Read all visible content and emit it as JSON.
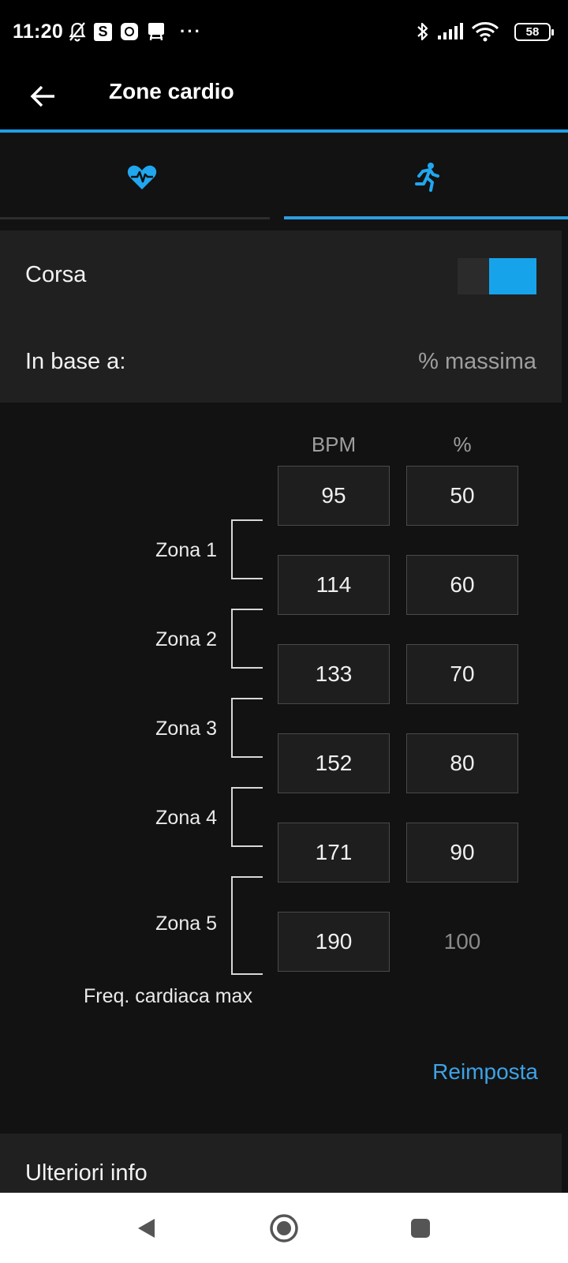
{
  "status_bar": {
    "time": "11:20",
    "s_badge": "S",
    "more_dots": "···",
    "battery": "58",
    "icons": [
      "bell-off-icon",
      "s-app-icon",
      "app-icon",
      "sim-icon",
      "bluetooth-icon",
      "signal-icon",
      "wifi-icon",
      "battery-icon"
    ]
  },
  "app_bar": {
    "title": "Zone cardio",
    "back_icon": "arrow-left-icon"
  },
  "tabs": [
    {
      "icon": "heart-rate-icon",
      "selected": false
    },
    {
      "icon": "running-icon",
      "selected": true
    }
  ],
  "settings": {
    "corsa_label": "Corsa",
    "corsa_enabled": true,
    "based_on_label": "In base a:",
    "based_on_value": "% massima"
  },
  "zones": {
    "bpm_header": "BPM",
    "pct_header": "%",
    "bpm_values": [
      "95",
      "114",
      "133",
      "152",
      "171",
      "190"
    ],
    "pct_values": [
      "50",
      "60",
      "70",
      "80",
      "90",
      "100"
    ],
    "zone_labels": [
      "Zona 1",
      "Zona 2",
      "Zona 3",
      "Zona 4",
      "Zona 5"
    ],
    "max_label": "Freq. cardiaca max"
  },
  "reset_label": "Reimposta",
  "more_info_label": "Ulteriori info",
  "nav_bar": {
    "icons": [
      "back-triangle-icon",
      "home-circle-icon",
      "recents-square-icon"
    ]
  },
  "colors": {
    "accent": "#1f9fe8",
    "background": "#121212",
    "card": "#202020",
    "link": "#3ea2e6"
  }
}
